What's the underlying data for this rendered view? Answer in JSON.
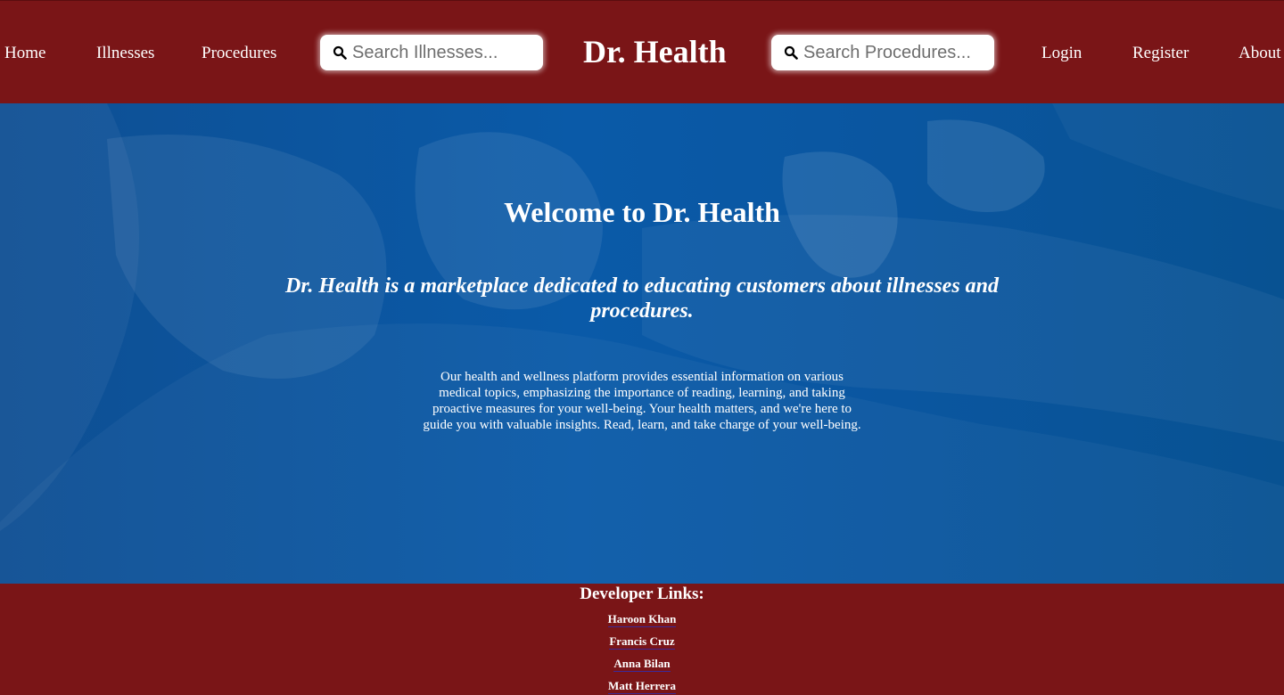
{
  "nav": {
    "home": "Home",
    "illnesses": "Illnesses",
    "procedures": "Procedures",
    "login": "Login",
    "register": "Register",
    "about": "About"
  },
  "brand": "Dr. Health",
  "search_illnesses": {
    "placeholder": "Search Illnesses..."
  },
  "search_procedures": {
    "placeholder": "Search Procedures..."
  },
  "hero": {
    "title": "Welcome to Dr. Health",
    "subtitle": "Dr. Health is a marketplace dedicated to educating customers about illnesses and procedures.",
    "body": "Our health and wellness platform provides essential information on various medical topics, emphasizing the importance of reading, learning, and taking proactive measures for your well-being. Your health matters, and we're here to guide you with valuable insights. Read, learn, and take charge of your well-being."
  },
  "footer": {
    "title": "Developer Links:",
    "links": [
      "Haroon Khan",
      "Francis Cruz",
      "Anna Bilan",
      "Matt Herrera"
    ]
  },
  "colors": {
    "header": "#7a1517",
    "hero": "#0a56a0",
    "text": "#ffffff"
  }
}
